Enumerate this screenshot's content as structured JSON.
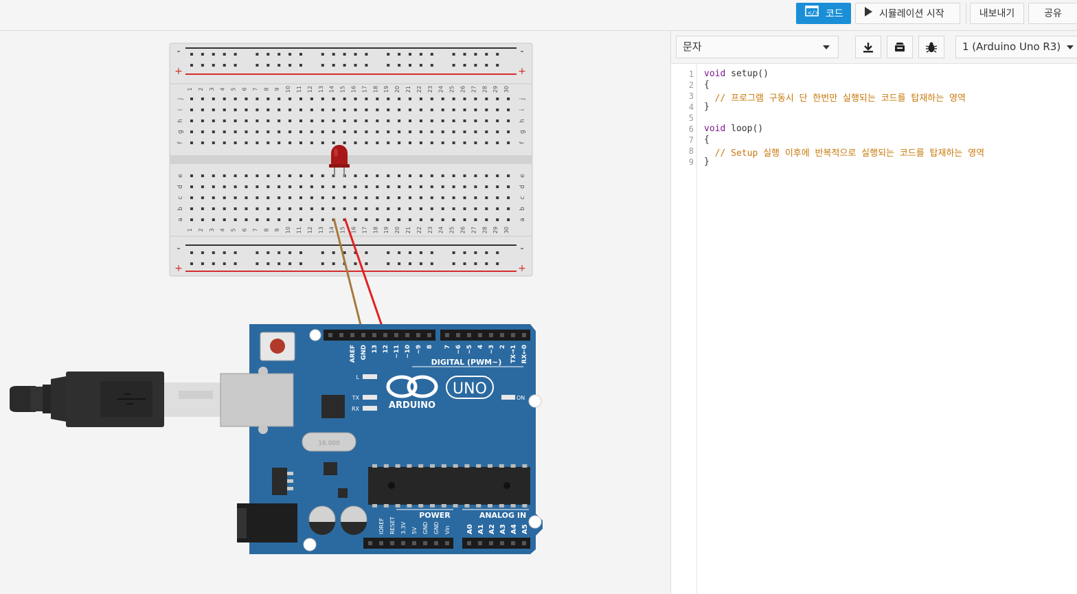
{
  "toolbar": {
    "code_label": "코드",
    "simulate_label": "시뮬레이션 시작",
    "export_label": "내보내기",
    "share_label": "공유"
  },
  "editor": {
    "mode_select": "문자",
    "device_select": "1 (Arduino Uno R3)",
    "line_numbers": [
      "1",
      "2",
      "3",
      "4",
      "5",
      "6",
      "7",
      "8",
      "9"
    ],
    "lines": [
      {
        "kw": "void",
        "rest": " setup()",
        "comment": ""
      },
      {
        "kw": "",
        "rest": "{",
        "comment": ""
      },
      {
        "kw": "",
        "rest": "  ",
        "comment": "// 프로그램 구동시 단 한번만 실행되는 코드를 탑재하는 영역"
      },
      {
        "kw": "",
        "rest": "}",
        "comment": ""
      },
      {
        "kw": "",
        "rest": "",
        "comment": ""
      },
      {
        "kw": "void",
        "rest": " loop()",
        "comment": ""
      },
      {
        "kw": "",
        "rest": "{",
        "comment": ""
      },
      {
        "kw": "",
        "rest": "  ",
        "comment": "// Setup 실행 이후에 반복적으로 실행되는 코드를 탑재하는 영역"
      },
      {
        "kw": "",
        "rest": "}",
        "comment": ""
      }
    ]
  },
  "breadboard": {
    "rail_minus": "-",
    "rail_plus": "+",
    "row_letters_top": [
      "j",
      "i",
      "h",
      "g",
      "f"
    ],
    "row_letters_bottom": [
      "e",
      "d",
      "c",
      "b",
      "a"
    ],
    "columns": [
      "1",
      "2",
      "3",
      "4",
      "5",
      "6",
      "7",
      "8",
      "9",
      "10",
      "11",
      "12",
      "13",
      "14",
      "15",
      "16",
      "17",
      "18",
      "19",
      "20",
      "21",
      "22",
      "23",
      "24",
      "25",
      "26",
      "27",
      "28",
      "29",
      "30"
    ]
  },
  "arduino": {
    "brand": "ARDUINO",
    "model": "UNO",
    "digital_label": "DIGITAL (PWM~)",
    "power_label": "POWER",
    "analog_label": "ANALOG IN",
    "led_l": "L",
    "led_tx": "TX",
    "led_rx": "RX",
    "led_on": "ON",
    "crystal": "16.000",
    "digital_pins": [
      "AREF",
      "GND",
      "13",
      "12",
      "~11",
      "~10",
      "~9",
      "8",
      "7",
      "~6",
      "~5",
      "4",
      "~3",
      "2",
      "TX→1",
      "RX←0"
    ],
    "power_pins": [
      "IOREF",
      "RESET",
      "3.3V",
      "5V",
      "GND",
      "GND",
      "Vin"
    ],
    "analog_pins": [
      "A0",
      "A1",
      "A2",
      "A3",
      "A4",
      "A5"
    ]
  },
  "colors": {
    "accent": "#1a8fd8",
    "board_blue": "#2b6aa0",
    "wire_brown": "#a6793a",
    "wire_red": "#e02020",
    "led_red": "#a81818"
  }
}
